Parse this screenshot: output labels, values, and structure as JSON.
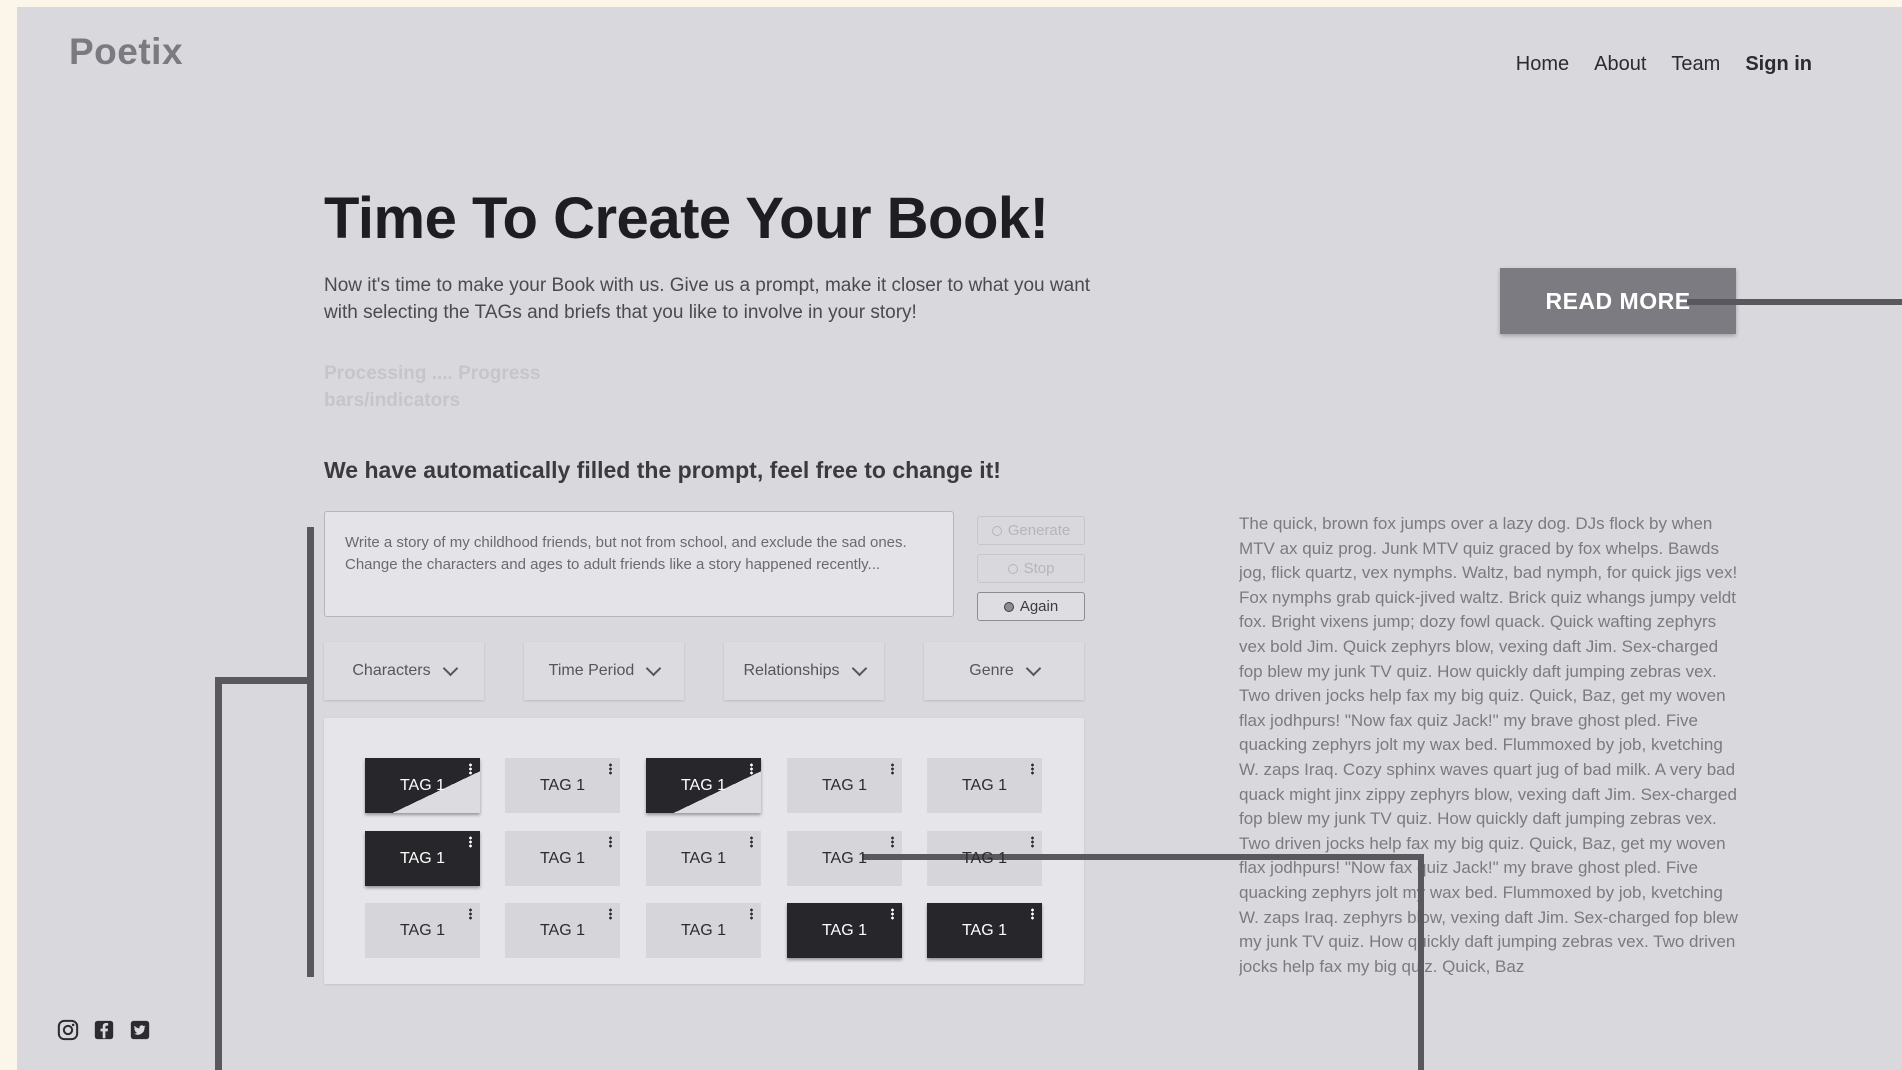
{
  "header": {
    "logo": "Poetix",
    "nav": [
      {
        "label": "Home"
      },
      {
        "label": "About"
      },
      {
        "label": "Team"
      },
      {
        "label": "Sign in"
      }
    ]
  },
  "hero": {
    "title": "Time To Create Your Book!",
    "subtitle": "Now it's time to make your Book with us. Give us a prompt, make it closer to what you want with selecting the TAGs and briefs that you like to involve in your story!",
    "processing": "Processing ....  Progress bars/indicators",
    "autofill_heading": "We have automatically filled the prompt, feel free to change it!"
  },
  "prompt": {
    "text": "Write a story of my childhood friends, but not from school, and exclude the sad ones. Change the characters and ages to adult friends like a story happened recently..."
  },
  "controls": {
    "generate": "Generate",
    "stop": "Stop",
    "again": "Again"
  },
  "filters": [
    {
      "label": "Characters"
    },
    {
      "label": "Time Period"
    },
    {
      "label": "Relationships"
    },
    {
      "label": "Genre"
    }
  ],
  "tags": [
    [
      {
        "label": "TAG 1",
        "state": "half"
      },
      {
        "label": "TAG 1",
        "state": "light"
      },
      {
        "label": "TAG 1",
        "state": "half"
      },
      {
        "label": "TAG 1",
        "state": "light"
      },
      {
        "label": "TAG 1",
        "state": "light"
      }
    ],
    [
      {
        "label": "TAG 1",
        "state": "dark"
      },
      {
        "label": "TAG 1",
        "state": "light"
      },
      {
        "label": "TAG 1",
        "state": "light"
      },
      {
        "label": "TAG 1",
        "state": "light"
      },
      {
        "label": "TAG 1",
        "state": "light"
      }
    ],
    [
      {
        "label": "TAG 1",
        "state": "light"
      },
      {
        "label": "TAG 1",
        "state": "light"
      },
      {
        "label": "TAG 1",
        "state": "light"
      },
      {
        "label": "TAG 1",
        "state": "dark"
      },
      {
        "label": "TAG 1",
        "state": "dark"
      }
    ]
  ],
  "cta": {
    "read_more": "READ MORE"
  },
  "sample_text": "The quick, brown fox jumps over a lazy dog. DJs flock by when MTV ax quiz prog. Junk MTV quiz graced by fox whelps. Bawds jog, flick quartz, vex nymphs. Waltz, bad nymph, for quick jigs vex! Fox nymphs grab quick-jived waltz. Brick quiz whangs jumpy veldt fox. Bright vixens jump; dozy fowl quack. Quick wafting zephyrs vex bold Jim. Quick zephyrs blow, vexing daft Jim. Sex-charged fop blew my junk TV quiz. How quickly daft jumping zebras vex. Two driven jocks help fax my big quiz. Quick, Baz, get my woven flax jodhpurs! \"Now fax quiz Jack!\" my brave ghost pled. Five quacking zephyrs jolt my wax bed. Flummoxed by job, kvetching W. zaps Iraq. Cozy sphinx waves quart jug of bad milk. A very bad quack might jinx zippy zephyrs blow, vexing daft Jim. Sex-charged fop blew my junk TV quiz. How quickly daft jumping zebras vex. Two driven jocks help fax my big quiz. Quick, Baz, get my woven flax jodhpurs! \"Now fax quiz Jack!\" my brave ghost pled. Five quacking zephyrs jolt my wax bed. Flummoxed by job, kvetching W. zaps Iraq. zephyrs blow, vexing daft Jim. Sex-charged fop blew my junk TV quiz. How quickly daft jumping zebras vex. Two driven jocks help fax my big quiz. Quick, Baz",
  "social": [
    "instagram-icon",
    "facebook-icon",
    "twitter-icon"
  ],
  "colors": {
    "page_bg": "#d9d9dd",
    "outer_bg": "#fcf5ea",
    "tag_dark": "#27272b",
    "tag_light": "#d6d6da",
    "cta_bg": "#7b7b81"
  }
}
